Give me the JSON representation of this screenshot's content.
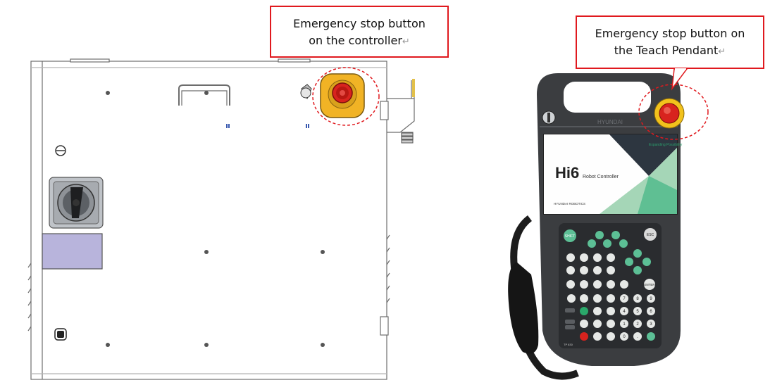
{
  "callouts": {
    "controller": {
      "line1": "Emergency stop button",
      "line2": "on the controller",
      "mark": "↵"
    },
    "pendant": {
      "line1": "Emergency stop button on",
      "line2": "the Teach Pendant",
      "mark": "↵"
    }
  },
  "pendant_screen": {
    "brand": "Hi6",
    "subtitle": "Robot Controller",
    "tagline": "Expanding Possibility",
    "maker": "HYUNDAI ROBOTICS",
    "top_logo": "HYUNDAI"
  },
  "keypad": {
    "shift": "SHIFT",
    "esc": "ESC",
    "enter": "ENTER",
    "digits": [
      "7",
      "8",
      "9",
      "4",
      "5",
      "6",
      "1",
      "2",
      "3",
      "0",
      "."
    ],
    "model": "TP 630"
  },
  "colors": {
    "callout_border": "#e0191e",
    "estop_red": "#d8231e",
    "estop_yellow": "#f1b325",
    "key_green": "#5cbf95",
    "pendant_body": "#3b3d40"
  }
}
